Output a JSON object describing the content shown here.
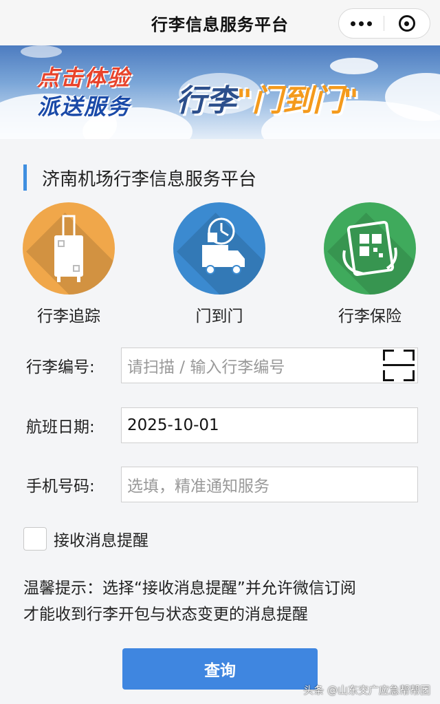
{
  "navbar": {
    "title": "行李信息服务平台"
  },
  "banner": {
    "promo_line1": "点击体验",
    "promo_line2": "派送服务",
    "slogan_prefix": "行李",
    "slogan_highlight": "\"门到门\""
  },
  "section": {
    "title": "济南机场行李信息服务平台"
  },
  "services": [
    {
      "label": "行李追踪",
      "icon": "suitcase-icon",
      "color": "#f0a74a"
    },
    {
      "label": "门到门",
      "icon": "delivery-truck-icon",
      "color": "#3b8ad0"
    },
    {
      "label": "行李保险",
      "icon": "qr-phone-icon",
      "color": "#3faa5c"
    }
  ],
  "form": {
    "baggage_number": {
      "label": "行李编号:",
      "placeholder": "请扫描 / 输入行李编号",
      "value": ""
    },
    "flight_date": {
      "label": "航班日期:",
      "value": "2025-10-01"
    },
    "phone": {
      "label": "手机号码:",
      "placeholder": "选填，精准通知服务",
      "value": ""
    },
    "notify": {
      "label": "接收消息提醒",
      "checked": false
    }
  },
  "tip": {
    "line1": "温馨提示：选择“接收消息提醒”并允许微信订阅",
    "line2": "才能收到行李开包与状态变更的消息提醒"
  },
  "query_button": {
    "label": "查询"
  },
  "watermark": "头条 @山东交广应急帮帮团"
}
